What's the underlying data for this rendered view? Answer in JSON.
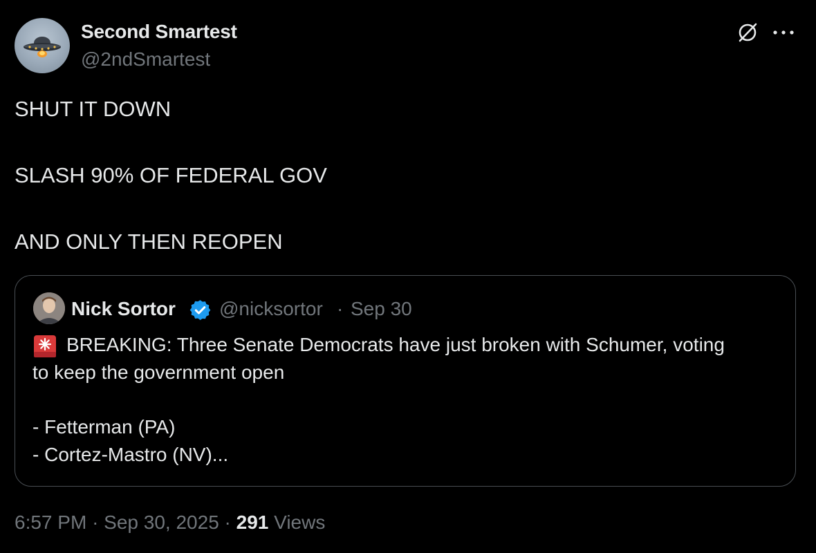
{
  "author": {
    "name": "Second Smartest",
    "handle": "@2ndSmartest",
    "avatar_icon": "ufo-icon"
  },
  "header_actions": {
    "grok_icon": "grok-icon",
    "more_icon": "more-icon"
  },
  "tweet": {
    "lines": [
      "SHUT IT DOWN",
      "SLASH 90% OF FEDERAL GOV",
      "AND ONLY THEN REOPEN"
    ]
  },
  "quoted": {
    "name": "Nick Sortor",
    "handle": "@nicksortor",
    "separator": "·",
    "date": "Sep 30",
    "verified_color": "#1d9bf0",
    "siren_icon": "police-light-icon",
    "line1": "BREAKING: Three Senate Democrats have just broken with Schumer, voting",
    "line2": "to keep the government open",
    "line3": "- Fetterman (PA)",
    "line4": "- Cortez-Mastro (NV)..."
  },
  "footer": {
    "time": "6:57 PM",
    "sep1": "·",
    "date": "Sep 30, 2025",
    "sep2": "·",
    "views_count": "291",
    "views_label": "Views"
  },
  "colors": {
    "background": "#000000",
    "text": "#e7e9ea",
    "muted": "#71767b",
    "border": "#4a4f54"
  }
}
